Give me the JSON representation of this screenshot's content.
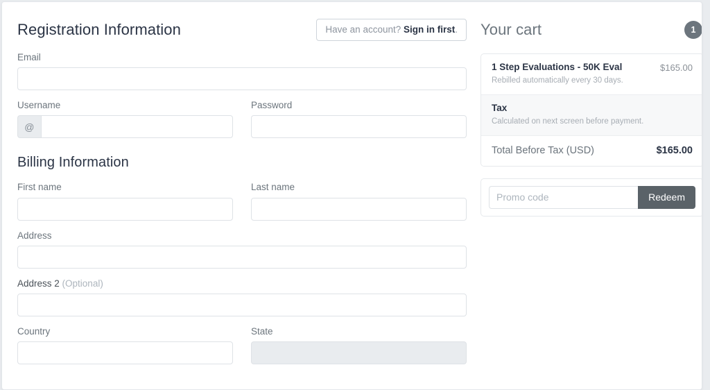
{
  "form": {
    "title": "Registration Information",
    "signin_prompt": "Have an account? ",
    "signin_link": "Sign in first",
    "signin_suffix": ".",
    "email_label": "Email",
    "email_value": "",
    "username_label": "Username",
    "username_addon": "@",
    "username_value": "",
    "password_label": "Password",
    "password_value": "",
    "billing_title": "Billing Information",
    "first_name_label": "First name",
    "first_name_value": "",
    "last_name_label": "Last name",
    "last_name_value": "",
    "address_label": "Address",
    "address_value": "",
    "address2_label_main": "Address 2 ",
    "address2_label_optional": "(Optional)",
    "address2_value": "",
    "country_label": "Country",
    "country_value": "",
    "state_label": "State",
    "state_value": ""
  },
  "cart": {
    "title": "Your cart",
    "badge_count": "1",
    "items": [
      {
        "name": "1 Step Evaluations - 50K Eval",
        "subtitle": "Rebilled automatically every 30 days.",
        "price": "$165.00"
      },
      {
        "name": "Tax",
        "subtitle": "Calculated on next screen before payment.",
        "price": ""
      }
    ],
    "total_label": "Total Before Tax (USD)",
    "total_value": "$165.00",
    "promo_placeholder": "Promo code",
    "promo_value": "",
    "redeem_label": "Redeem"
  },
  "colors": {
    "heading": "#2b3445",
    "muted": "#6c757d",
    "badge_bg": "#6c757d",
    "redeem_bg": "#5a6268",
    "border": "#dee2e6",
    "shaded_row": "#f7f8f9"
  }
}
